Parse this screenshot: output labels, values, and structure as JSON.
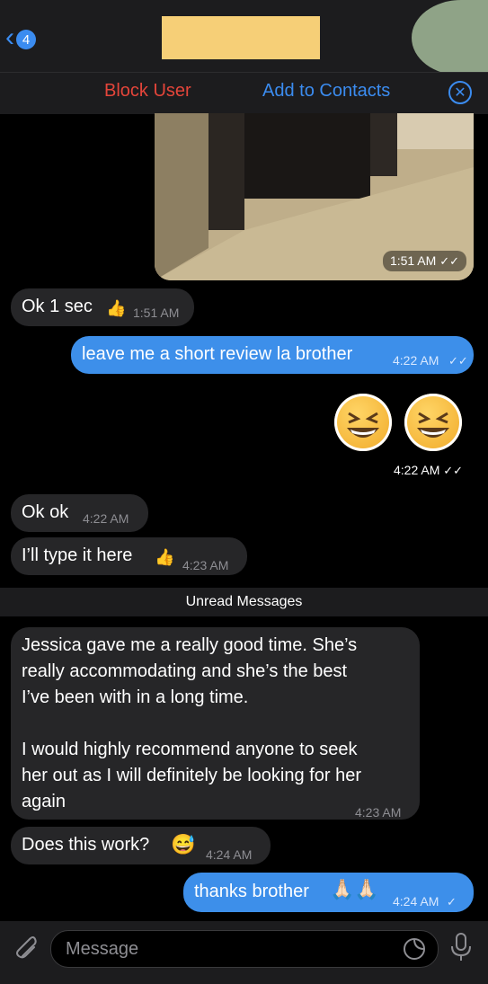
{
  "header": {
    "unread_count": "4",
    "block_label": "Block User",
    "add_label": "Add to Contacts"
  },
  "photo": {
    "time": "1:51 AM"
  },
  "messages": [
    {
      "text": "Ok 1 sec",
      "time": "1:51 AM",
      "emoji": "👍"
    },
    {
      "text": "leave me a short review la brother",
      "time": "4:22 AM"
    },
    {
      "time": "4:22 AM"
    },
    {
      "text": "Ok ok",
      "time": "4:22 AM"
    },
    {
      "text": "I’ll type it here",
      "time": "4:23 AM",
      "emoji": "👍"
    },
    {
      "line1": "Jessica gave me a really good time. She’s",
      "line2": "really accommodating and she’s the best",
      "line3": "I’ve been with in a long time.",
      "line4": "I would highly recommend anyone to seek",
      "line5": "her out as I will definitely be looking for her",
      "line6": "again",
      "time": "4:23 AM"
    },
    {
      "text": "Does this work?",
      "time": "4:24 AM",
      "emoji": "😅"
    },
    {
      "text": "thanks brother",
      "time": "4:24 AM",
      "emoji": "🙏🏻🙏🏻"
    }
  ],
  "unread_label": "Unread Messages",
  "composer": {
    "placeholder": "Message"
  }
}
